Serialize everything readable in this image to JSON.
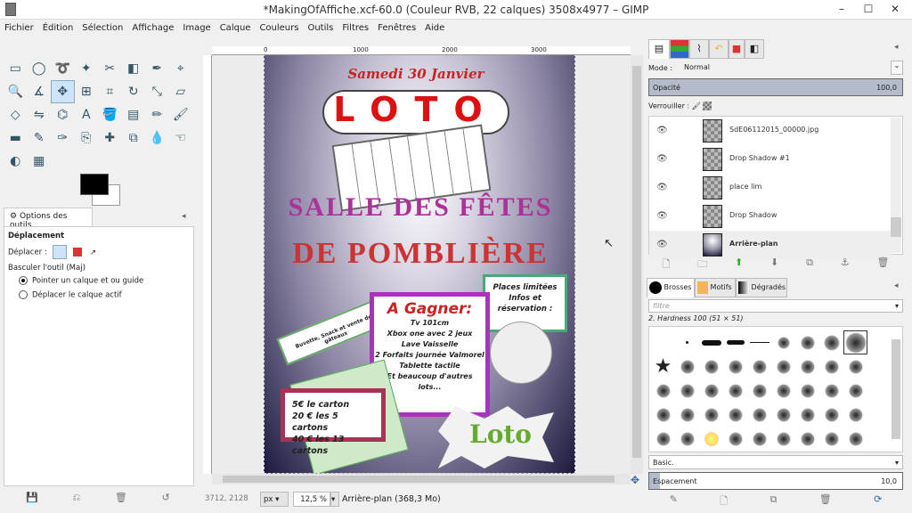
{
  "window": {
    "title": "*MakingOfAffiche.xcf-60.0 (Couleur RVB, 22 calques) 3508x4977 – GIMP",
    "minimize": "–",
    "maximize": "☐",
    "close": "✕"
  },
  "menu": [
    "Fichier",
    "Édition",
    "Sélection",
    "Affichage",
    "Image",
    "Calque",
    "Couleurs",
    "Outils",
    "Filtres",
    "Fenêtres",
    "Aide"
  ],
  "tools": [
    "rect-select",
    "ellipse-select",
    "lasso",
    "fuzzy-select",
    "scissors",
    "foreground-select",
    "paths",
    "color-picker",
    "zoom",
    "measure",
    "move",
    "align",
    "crop",
    "rotate",
    "scale",
    "shear",
    "perspective",
    "flip",
    "cage",
    "text",
    "bucket-fill",
    "blend",
    "pencil",
    "paintbrush",
    "eraser",
    "airbrush",
    "ink",
    "clone",
    "heal",
    "perspective-clone",
    "blur",
    "smudge",
    "dodge-burn",
    "color-select"
  ],
  "tool_glyphs": [
    "▭",
    "◯",
    "➰",
    "✦",
    "✂",
    "◧",
    "✒",
    "⌖",
    "🔍",
    "∡",
    "✥",
    "⊞",
    "⌗",
    "↻",
    "⤡",
    "▱",
    "◇",
    "⇋",
    "⌬",
    "A",
    "🪣",
    "▤",
    "✏",
    "🖌",
    "▬",
    "✎",
    "✑",
    "⎘",
    "✚",
    "⧉",
    "💧",
    "☜",
    "◐",
    "▦"
  ],
  "active_tool": 10,
  "colors": {
    "foreground": "#000000",
    "background": "#ffffff",
    "accent": "#cde3f7"
  },
  "tool_options": {
    "tab": "Options des outils",
    "tool_name": "Déplacement",
    "move_label": "Déplacer :",
    "toggle_label": "Basculer l'outil  (Maj)",
    "options": [
      "Pointer un calque et ou guide",
      "Déplacer le calque actif"
    ],
    "selected_option": 0
  },
  "ruler": {
    "ticks": [
      "0",
      "1000",
      "2000",
      "3000"
    ]
  },
  "poster": {
    "date": "Samedi 30 Janvier",
    "title": "LOTO",
    "venue1": "SALLE DES FÊTES",
    "venue2": "DE POMBLIÈRE",
    "buvette": "Buvette, Snack et vente de gâteaux",
    "places": [
      "Places limitées",
      "Infos et",
      "réservation :"
    ],
    "gagner": "A Gagner:",
    "prizes": [
      "Tv 101cm",
      "Xbox one avec 2 jeux",
      "Lave Vaisselle",
      "2 Forfaits journée Valmorel",
      "Tablette tactile",
      "Et beaucoup d'autres",
      "lots..."
    ],
    "prices": [
      "5€ le carton",
      "20 € les 5 cartons",
      "40 € les 13 cartons"
    ],
    "logo": "Loto"
  },
  "status": {
    "coords": "3712, 2128",
    "unit": "px",
    "zoom": "12,5 %",
    "info": "Arrière-plan (368,3 Mo)"
  },
  "layers": {
    "mode_label": "Mode :",
    "mode_value": "Normal",
    "opacity_label": "Opacité",
    "opacity_value": "100,0",
    "lock_label": "Verrouiller :",
    "items": [
      {
        "name": "SdE06112015_00000.jpg",
        "active": false
      },
      {
        "name": "Drop Shadow #1",
        "active": false
      },
      {
        "name": "place lim",
        "active": false
      },
      {
        "name": "Drop Shadow",
        "active": false
      },
      {
        "name": "Arrière-plan",
        "active": true
      }
    ]
  },
  "brushes": {
    "tabs": [
      "Brosses",
      "Motifs",
      "Dégradés"
    ],
    "filter_placeholder": "filtre",
    "selected": "2. Hardness 100 (51 × 51)",
    "preset": "Basic.",
    "spacing_label": "Espacement",
    "spacing_value": "10,0"
  }
}
